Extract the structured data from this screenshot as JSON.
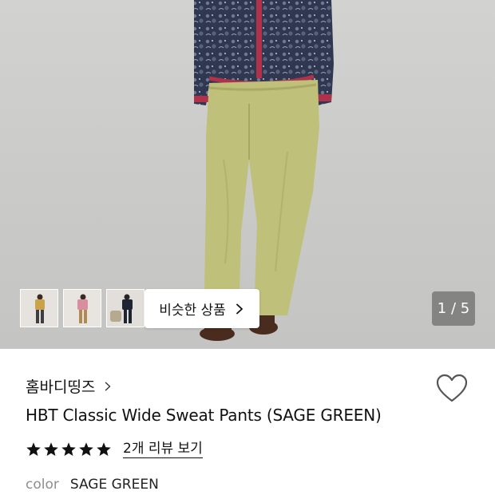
{
  "gallery": {
    "counter": "1 / 5",
    "similar_label": "비슷한 상품",
    "thumbnails": [
      "thumb-1",
      "thumb-2",
      "thumb-3"
    ]
  },
  "product": {
    "brand": "홈바디띵즈",
    "title": "HBT Classic Wide Sweat Pants (SAGE GREEN)",
    "rating": 5,
    "review_link": "2개 리뷰 보기",
    "color_label": "color",
    "color_value": "SAGE GREEN"
  },
  "icons": {
    "heart": "heart-outline-icon",
    "chevron": "chevron-right-icon",
    "star": "star-filled-icon"
  },
  "colors": {
    "pants": "#bfc07a",
    "fleece": "#2f3850",
    "trim": "#b0324a",
    "shoes": "#4a2b1f",
    "star": "#111111"
  }
}
